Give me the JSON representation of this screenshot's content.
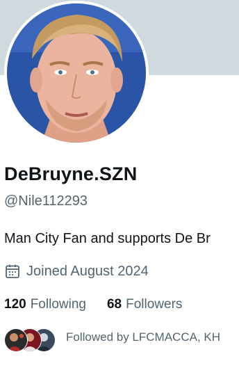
{
  "profile": {
    "display_name": "DeBruyne.SZN",
    "handle": "@Nile112293",
    "bio": "Man City Fan and supports De Br",
    "joined": "Joined August 2024",
    "following_count": "120",
    "following_label": "Following",
    "followers_count": "68",
    "followers_label": "Followers",
    "followed_by": "Followed by LFCMACCA, KH"
  },
  "icons": {
    "joined": "calendar-icon"
  },
  "colors": {
    "banner": "#cfd9de",
    "text_primary": "#0f1419",
    "text_secondary": "#536471"
  }
}
